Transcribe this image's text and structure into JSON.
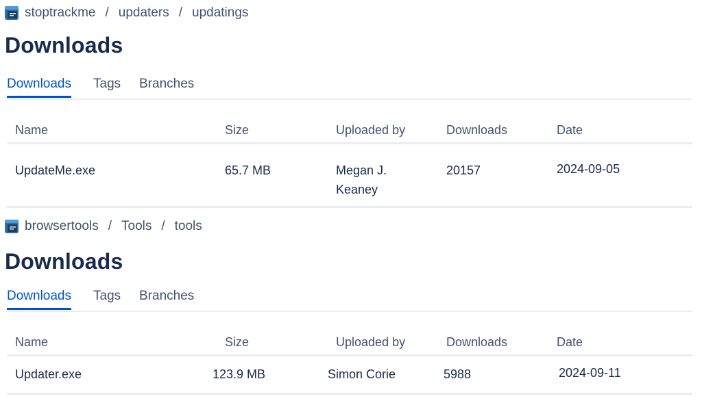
{
  "colors": {
    "accent": "#0052cc",
    "text_primary": "#172b4d",
    "text_secondary": "#42526e",
    "divider": "#ebecf0"
  },
  "sections": [
    {
      "breadcrumb": {
        "icon": "repository-icon",
        "items": [
          "stoptrackme",
          "updaters",
          "updatings"
        ],
        "separator": "/"
      },
      "title": "Downloads",
      "tabs": [
        {
          "label": "Downloads",
          "active": true
        },
        {
          "label": "Tags",
          "active": false
        },
        {
          "label": "Branches",
          "active": false
        }
      ],
      "table": {
        "columns": [
          "Name",
          "Size",
          "Uploaded by",
          "Downloads",
          "Date"
        ],
        "rows": [
          {
            "name": "UpdateMe.exe",
            "size": "65.7 MB",
            "uploaded_by_line1": "Megan J.",
            "uploaded_by_line2": "Keaney",
            "downloads": "20157",
            "date": "2024-09-05"
          }
        ]
      }
    },
    {
      "breadcrumb": {
        "icon": "repository-icon",
        "items": [
          "browsertools",
          "Tools",
          "tools"
        ],
        "separator": "/"
      },
      "title": "Downloads",
      "tabs": [
        {
          "label": "Downloads",
          "active": true
        },
        {
          "label": "Tags",
          "active": false
        },
        {
          "label": "Branches",
          "active": false
        }
      ],
      "table": {
        "columns": [
          "Name",
          "Size",
          "Uploaded by",
          "Downloads",
          "Date"
        ],
        "rows": [
          {
            "name": "Updater.exe",
            "size": "123.9 MB",
            "uploaded_by": "Simon Corie",
            "downloads": "5988",
            "date": "2024-09-11"
          }
        ]
      }
    }
  ]
}
